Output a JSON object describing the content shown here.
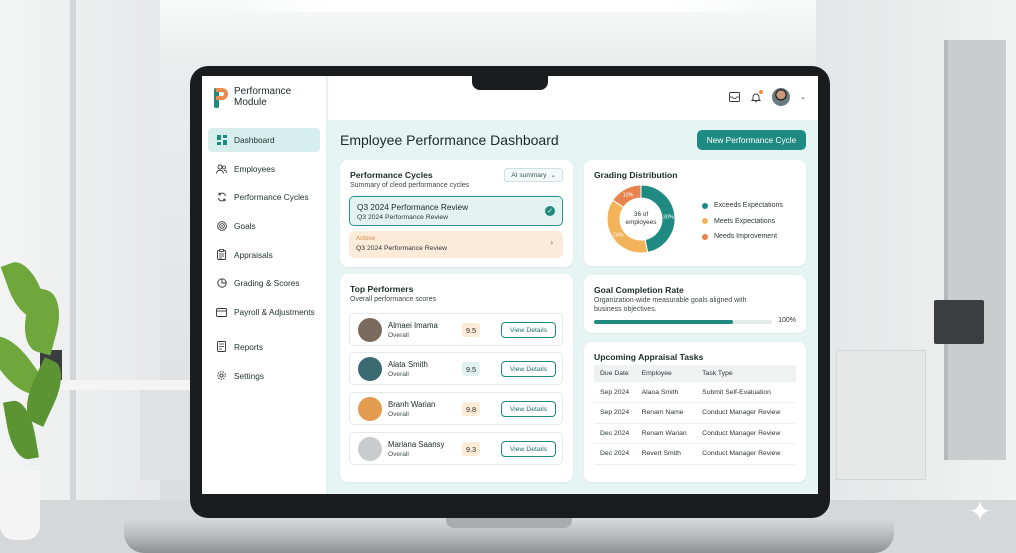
{
  "colors": {
    "accent": "#1f8a82",
    "exceeds": "#1f8a82",
    "meets": "#f2b35a",
    "needs": "#e8834d"
  },
  "brand": {
    "line1": "Performance",
    "line2": "Module"
  },
  "sidebar": {
    "items": [
      {
        "label": "Dashboard",
        "icon": "grid-icon",
        "active": true
      },
      {
        "label": "Employees",
        "icon": "users-icon"
      },
      {
        "label": "Performance Cycles",
        "icon": "refresh-icon"
      },
      {
        "label": "Goals",
        "icon": "target-icon"
      },
      {
        "label": "Appraisals",
        "icon": "clipboard-icon"
      },
      {
        "label": "Grading & Scores",
        "icon": "pie-icon"
      },
      {
        "label": "Payroll & Adjustments",
        "icon": "receipt-icon"
      },
      {
        "label": "Reports",
        "icon": "report-icon"
      },
      {
        "label": "Settings",
        "icon": "gear-icon"
      }
    ]
  },
  "header": {
    "title": "Employee Performance Dashboard",
    "new_cycle_label": "New Performance Cycle"
  },
  "performance_cycles": {
    "title": "Performance Cycles",
    "subtitle": "Summary of cleod performance cycles",
    "ai_summary_label": "AI summary",
    "items": [
      {
        "title": "Q3 2024 Performance Review",
        "subtitle": "Q3 2024 Performance Review",
        "selected": true
      },
      {
        "status": "Actove",
        "subtitle": "Q3 2024 Performance Review"
      }
    ]
  },
  "top_performers": {
    "title": "Top Performers",
    "subtitle": "Overall performance scores",
    "view_label": "View Details",
    "rows": [
      {
        "name": "Almaei Imama",
        "sub": "Overall",
        "score": "9.5",
        "score_bg": "#fcebd6",
        "avatar": "#7a6a5e"
      },
      {
        "name": "Alata Smith",
        "sub": "Overall",
        "score": "9.5",
        "score_bg": "#e1f1ef",
        "avatar": "#3b6b72"
      },
      {
        "name": "Branh Warian",
        "sub": "Overall",
        "score": "9.8",
        "score_bg": "#fcebd6",
        "avatar": "#e39b50"
      },
      {
        "name": "Mariana Saansy",
        "sub": "Overall",
        "score": "9.3",
        "score_bg": "#fcebd6",
        "avatar": "#c9cccc"
      }
    ]
  },
  "grading": {
    "title": "Grading Distribution",
    "center_line1": "36 of",
    "center_line2": "employees",
    "legend": [
      {
        "label": "Exceeds Expectations",
        "color": "#1f8a82"
      },
      {
        "label": "Meets Expectations",
        "color": "#f2b35a"
      },
      {
        "label": "Needs Improvement",
        "color": "#e8834d"
      }
    ]
  },
  "chart_data": {
    "type": "pie",
    "title": "Grading Distribution",
    "categories": [
      "Exceeds Expectations",
      "Meets Expectations",
      "Needs Improvement"
    ],
    "values": [
      30,
      24,
      10
    ],
    "data_labels": [
      "30%",
      "24%",
      "10%"
    ],
    "colors": [
      "#1f8a82",
      "#f2b35a",
      "#e8834d"
    ],
    "legend_position": "right"
  },
  "goal_completion": {
    "title": "Goal Completion Rate",
    "subtitle": "Organization-wide measurable goals aligned with business objectives.",
    "progress": 0.78,
    "label": "100%"
  },
  "appraisal_tasks": {
    "title": "Upcoming Appraisal Tasks",
    "columns": [
      "Due Date",
      "Employee",
      "Task Type"
    ],
    "rows": [
      [
        "Sep 2024",
        "Alaoa Smith",
        "Submit Self-Evaluation"
      ],
      [
        "Sep 2024",
        "Renam Name",
        "Conduct Manager Review"
      ],
      [
        "Dec 2024",
        "Renam Warian",
        "Conduct Manager Review"
      ],
      [
        "Dec 2024",
        "Revert Smith",
        "Conduct Manager Review"
      ]
    ]
  }
}
